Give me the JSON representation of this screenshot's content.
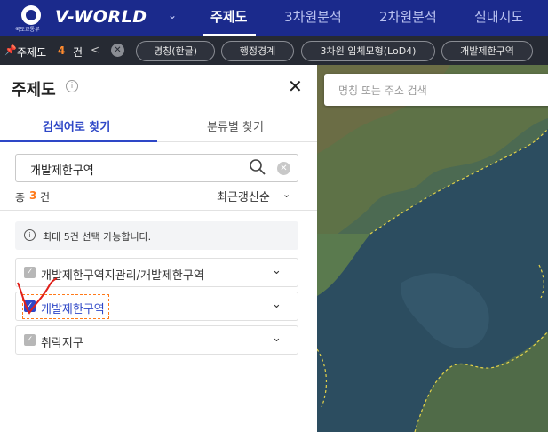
{
  "header": {
    "ministry": "국토교통부",
    "brand": "V-WORLD",
    "menus": [
      {
        "label": "주제도",
        "active": true
      },
      {
        "label": "3차원분석",
        "active": false
      },
      {
        "label": "2차원분석",
        "active": false
      },
      {
        "label": "실내지도",
        "active": false
      }
    ]
  },
  "filter_bar": {
    "title": "주제도",
    "count": "4",
    "unit": "건",
    "back_symbol": "<",
    "chips": [
      "명칭(한글)",
      "행정경계",
      "3차원 입체모형(LoD4)",
      "개발제한구역"
    ]
  },
  "panel": {
    "title": "주제도",
    "tabs": [
      {
        "label": "검색어로 찾기",
        "active": true
      },
      {
        "label": "분류별 찾기",
        "active": false
      }
    ],
    "search_value": "개발제한구역",
    "total_label": "총",
    "total_count": "3",
    "total_unit": "건",
    "sort_label": "최근갱신순",
    "notice": "최대 5건 선택 가능합니다.",
    "items": [
      {
        "label": "개발제한구역지관리/개발제한구역",
        "checked": false
      },
      {
        "label": "개발제한구역",
        "checked": true
      },
      {
        "label": "취락지구",
        "checked": false
      }
    ]
  },
  "map": {
    "search_placeholder": "명칭 또는 주소 검색"
  },
  "colors": {
    "nav_bg": "#1b2a8c",
    "filter_bg": "#262a33",
    "accent": "#2e47c7",
    "count_orange": "#ff7a1a",
    "annotation_red": "#e0201a"
  },
  "icons": [
    "emblem-icon",
    "chevron-down-icon",
    "pin-icon",
    "back-icon",
    "clear-icon",
    "info-icon",
    "close-icon",
    "search-icon",
    "checkbox-icon"
  ]
}
